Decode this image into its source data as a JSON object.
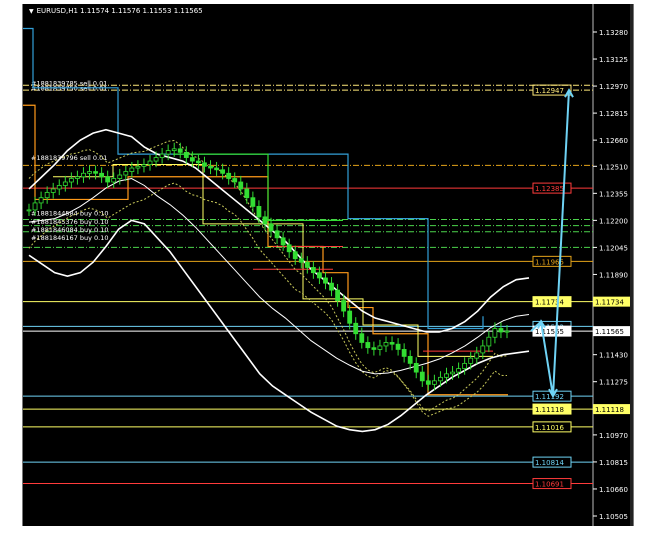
{
  "window": {
    "symbol": "EURUSD,H1",
    "ohlc": "1.11574 1.11576 1.11553 1.11565",
    "title_arrow_icon": "dropdown-triangle-icon"
  },
  "colors": {
    "background": "#000000",
    "axis": "#ffffff",
    "candles": "#33dd33",
    "bands": "#ffffff",
    "ma_dotted": "#c8c85a",
    "upper_channel": "#33a0d8",
    "lower_channel": "#ff9a1a",
    "yellow_channel": "#ffff66",
    "forecast_arrow": "#6fd3f5",
    "gridline": "#ffffff"
  },
  "price_axis": {
    "min": 1.10505,
    "max": 1.1338,
    "ticks": [
      "1.13280",
      "1.13125",
      "1.12970",
      "1.12815",
      "1.12660",
      "1.12510",
      "1.12355",
      "1.12200",
      "1.12045",
      "1.11890",
      "1.11730",
      "1.11580",
      "1.11430",
      "1.11275",
      "1.11120",
      "1.10970",
      "1.10815",
      "1.10660",
      "1.10505"
    ]
  },
  "order_labels": [
    {
      "text": "#1881839785 sell 0.01",
      "price": 1.12985,
      "color": "#ffffff"
    },
    {
      "text": "#1881839750 sell 0.01",
      "price": 1.12955,
      "color": "#ffffff"
    },
    {
      "text": "#1881839796 sell 0.01",
      "price": 1.12558,
      "color": "#ffffff"
    },
    {
      "text": "#1881844584 buy 0.10",
      "price": 1.12238,
      "color": "#ffffff"
    },
    {
      "text": "#1881845376 buy 0.10",
      "price": 1.12192,
      "color": "#ffffff"
    },
    {
      "text": "#1881846084 buy 0.10",
      "price": 1.12146,
      "color": "#ffffff"
    },
    {
      "text": "#1881846167 buy 0.10",
      "price": 1.12098,
      "color": "#ffffff"
    }
  ],
  "level_lines": [
    {
      "price": 1.12947,
      "color": "#ffe97a",
      "style": "dashdot",
      "label": "1.12947",
      "label_border": "#ffe97a",
      "label_text_color": "#ffe97a"
    },
    {
      "price": 1.12975,
      "color": "#ffe97a",
      "style": "dashdot",
      "label": "",
      "label_border": "",
      "label_text_color": ""
    },
    {
      "price": 1.12515,
      "color": "#e5a41a",
      "style": "dashdot",
      "label": "",
      "label_border": "",
      "label_text_color": ""
    },
    {
      "price": 1.12385,
      "color": "#ff3b3b",
      "style": "solid",
      "label": "1.12385",
      "label_border": "#ff3b3b",
      "label_text_color": "#ff3b3b"
    },
    {
      "price": 1.12205,
      "color": "#4cd44c",
      "style": "dashdot",
      "label": "",
      "label_border": "",
      "label_text_color": ""
    },
    {
      "price": 1.1217,
      "color": "#4cd44c",
      "style": "dashdot",
      "label": "",
      "label_border": "",
      "label_text_color": ""
    },
    {
      "price": 1.12135,
      "color": "#4cd44c",
      "style": "dashdot",
      "label": "",
      "label_border": "",
      "label_text_color": ""
    },
    {
      "price": 1.12045,
      "color": "#4cd44c",
      "style": "dashdot",
      "label": "",
      "label_border": "",
      "label_text_color": ""
    },
    {
      "price": 1.11965,
      "color": "#e5a41a",
      "style": "solid",
      "label": "1.11965",
      "label_border": "#e5a41a",
      "label_text_color": "#e5a41a"
    },
    {
      "price": 1.11734,
      "color": "#ffff66",
      "style": "solid",
      "label": "1.11734",
      "label_border": "#ffff66",
      "label_text_color": "#000000",
      "label_fill": "#ffff66"
    },
    {
      "price": 1.11592,
      "color": "#6fd3f5",
      "style": "solid",
      "label": "1.11592",
      "label_border": "#6fd3f5",
      "label_text_color": "#6fd3f5"
    },
    {
      "price": 1.11565,
      "color": "#ffffff",
      "style": "solid",
      "label": "1.11565",
      "label_border": "#ffffff",
      "label_text_color": "#000000",
      "label_fill": "#ffffff"
    },
    {
      "price": 1.11192,
      "color": "#6fd3f5",
      "style": "solid",
      "label": "1.11192",
      "label_border": "#6fd3f5",
      "label_text_color": "#6fd3f5"
    },
    {
      "price": 1.11118,
      "color": "#ffff66",
      "style": "solid",
      "label": "1.11118",
      "label_border": "#ffff66",
      "label_text_color": "#000000",
      "label_fill": "#ffff66"
    },
    {
      "price": 1.11016,
      "color": "#ffff66",
      "style": "solid",
      "label": "1.11016",
      "label_border": "#ffff66",
      "label_text_color": "#ffff66"
    },
    {
      "price": 1.10814,
      "color": "#6fd3f5",
      "style": "solid",
      "label": "1.10814",
      "label_border": "#6fd3f5",
      "label_text_color": "#6fd3f5"
    },
    {
      "price": 1.10691,
      "color": "#ff3b3b",
      "style": "solid",
      "label": "1.10691",
      "label_border": "#ff3b3b",
      "label_text_color": "#ff3b3b"
    }
  ],
  "chart_data": {
    "type": "candlestick",
    "symbol": "EURUSD",
    "timeframe": "H1",
    "ylim": [
      1.10505,
      1.1338
    ],
    "closes": [
      1.1226,
      1.123,
      1.1233,
      1.1236,
      1.1238,
      1.124,
      1.1242,
      1.1244,
      1.1245,
      1.1247,
      1.1248,
      1.1247,
      1.1245,
      1.1242,
      1.1244,
      1.1246,
      1.1248,
      1.125,
      1.1251,
      1.1252,
      1.1254,
      1.1256,
      1.1258,
      1.126,
      1.1261,
      1.1259,
      1.1256,
      1.1254,
      1.1253,
      1.1251,
      1.125,
      1.1249,
      1.1247,
      1.1244,
      1.1242,
      1.1238,
      1.1233,
      1.1228,
      1.1222,
      1.1218,
      1.1214,
      1.121,
      1.1206,
      1.1202,
      1.1198,
      1.1196,
      1.1193,
      1.119,
      1.1187,
      1.1184,
      1.118,
      1.1174,
      1.1168,
      1.1161,
      1.1155,
      1.115,
      1.1147,
      1.1146,
      1.1148,
      1.115,
      1.1149,
      1.1146,
      1.1142,
      1.1138,
      1.1133,
      1.1128,
      1.1126,
      1.1128,
      1.113,
      1.1132,
      1.1133,
      1.1135,
      1.1138,
      1.1141,
      1.1144,
      1.1148,
      1.1153,
      1.1158,
      1.1156,
      1.11565
    ],
    "bollinger_upper": [
      1.1238,
      1.1245,
      1.1252,
      1.126,
      1.1266,
      1.127,
      1.1272,
      1.127,
      1.1268,
      1.1262,
      1.1258,
      1.1256,
      1.1254,
      1.125,
      1.1244,
      1.1238,
      1.1232,
      1.1226,
      1.122,
      1.1214,
      1.1208,
      1.12,
      1.1192,
      1.1186,
      1.118,
      1.1174,
      1.1168,
      1.1164,
      1.1162,
      1.116,
      1.1158,
      1.1156,
      1.1156,
      1.1158,
      1.1162,
      1.1168,
      1.1176,
      1.1182,
      1.1186,
      1.1187
    ],
    "bollinger_lower": [
      1.12,
      1.1195,
      1.119,
      1.1188,
      1.119,
      1.1196,
      1.1205,
      1.1215,
      1.122,
      1.1218,
      1.121,
      1.1202,
      1.1192,
      1.1182,
      1.1172,
      1.1162,
      1.1152,
      1.1142,
      1.1132,
      1.1125,
      1.112,
      1.1115,
      1.111,
      1.1106,
      1.1102,
      1.11,
      1.1099,
      1.11,
      1.1103,
      1.1108,
      1.1114,
      1.112,
      1.1125,
      1.113,
      1.1134,
      1.1138,
      1.1141,
      1.1143,
      1.1144,
      1.1145
    ],
    "forecast": [
      1.11565,
      1.1162,
      1.11192,
      1.12947
    ]
  }
}
